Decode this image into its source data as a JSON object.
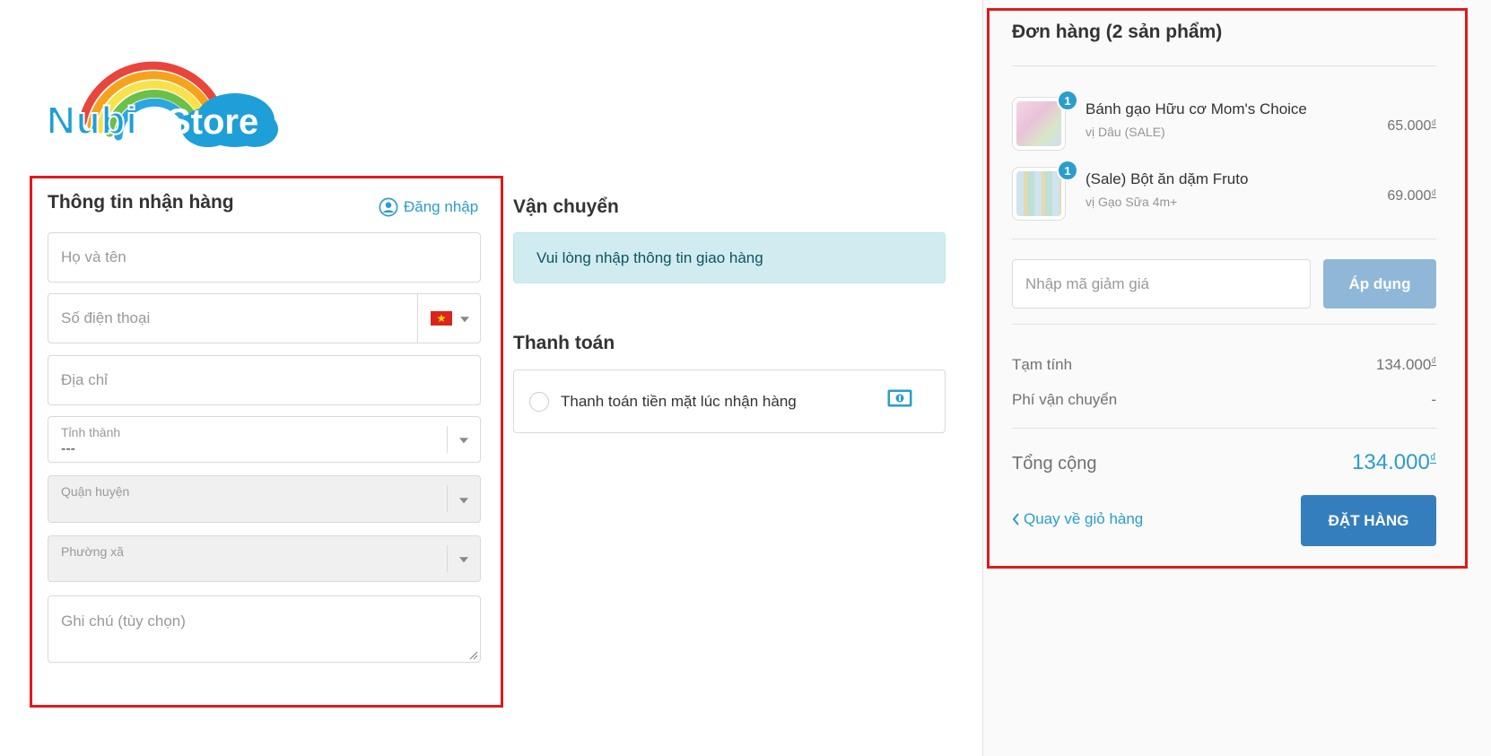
{
  "brand": {
    "logo_word1": "Nubi",
    "logo_word2": "Store",
    "rainbow_colors": [
      "#e8453c",
      "#f7a21b",
      "#f9e14b",
      "#6cc04a",
      "#2aa7df"
    ],
    "word_color": "#1e9fd8"
  },
  "receiving": {
    "title": "Thông tin nhận hàng",
    "login_link": "Đăng nhập",
    "fullname_placeholder": "Họ và tên",
    "phone_placeholder": "Số điện thoại",
    "country_flag": "vn-flag",
    "address_placeholder": "Địa chỉ",
    "province_label": "Tỉnh thành",
    "province_value": "---",
    "district_label": "Quận huyện",
    "ward_label": "Phường xã",
    "note_placeholder": "Ghi chú (tùy chọn)"
  },
  "shipping": {
    "title": "Vận chuyển",
    "alert": "Vui lòng nhập thông tin giao hàng"
  },
  "payment": {
    "title": "Thanh toán",
    "method": "Thanh toán tiền mặt lúc nhận hàng",
    "method_icon": "cash-icon"
  },
  "order": {
    "title": "Đơn hàng (2 sản phẩm)",
    "items": [
      {
        "qty": "1",
        "name": "Bánh gạo Hữu cơ Mom's Choice",
        "variant": "vị Dâu (SALE)",
        "price": "65.000",
        "currency": "₫"
      },
      {
        "qty": "1",
        "name": "(Sale) Bột ăn dặm Fruto",
        "variant": "vị Gạo Sữa 4m+",
        "price": "69.000",
        "currency": "₫"
      }
    ],
    "coupon_placeholder": "Nhập mã giảm giá",
    "apply_label": "Áp dụng",
    "subtotal_label": "Tạm tính",
    "subtotal_value": "134.000",
    "shipping_fee_label": "Phí vận chuyển",
    "shipping_fee_value": "-",
    "total_label": "Tổng cộng",
    "total_value": "134.000",
    "currency": "₫",
    "back_link": "Quay về giỏ hàng",
    "place_order": "ĐẶT HÀNG"
  },
  "colors": {
    "accent": "#2a9dcc",
    "primary_button": "#357ebd",
    "apply_button": "#8fb8d8",
    "highlight": "#e01b1b",
    "alert_bg": "#d1ecf1"
  }
}
